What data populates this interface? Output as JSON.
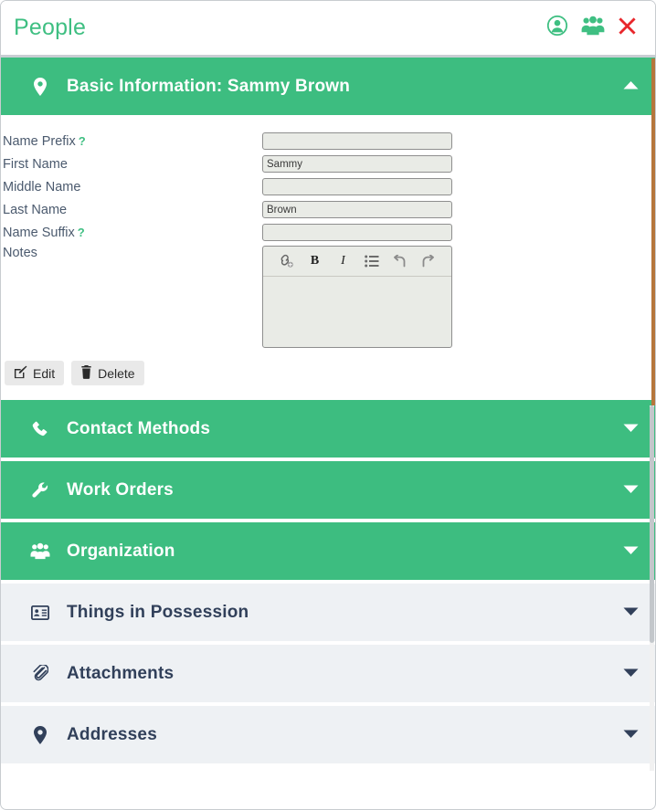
{
  "window": {
    "title": "People",
    "title_color": "#3fbf82"
  },
  "topbar": {
    "icons": [
      {
        "name": "user-circle-icon",
        "label": "User profile"
      },
      {
        "name": "users-group-icon",
        "label": "People"
      },
      {
        "name": "close-x-icon",
        "label": "Close"
      }
    ]
  },
  "colors": {
    "accent_green": "#3dbd80",
    "panel_grey": "#eef1f4",
    "label_text": "#4b5a6e",
    "header_text_dark": "#31405a",
    "close_red": "#e8262b",
    "input_bg": "#e9ebe6",
    "input_border": "#8e8e8e"
  },
  "sections": [
    {
      "key": "basic_information",
      "title": "Basic Information: Sammy Brown",
      "icon": "map-marker-icon",
      "style": "green",
      "expanded": true,
      "chevron": "chevron-up-icon"
    },
    {
      "key": "contact_methods",
      "title": "Contact Methods",
      "icon": "phone-icon",
      "style": "green",
      "expanded": false,
      "chevron": "chevron-down-icon"
    },
    {
      "key": "work_orders",
      "title": "Work Orders",
      "icon": "wrench-icon",
      "style": "green",
      "expanded": false,
      "chevron": "chevron-down-icon"
    },
    {
      "key": "organization",
      "title": "Organization",
      "icon": "users-group-icon",
      "style": "green",
      "expanded": false,
      "chevron": "chevron-down-icon"
    },
    {
      "key": "things_in_possession",
      "title": "Things in Possession",
      "icon": "id-card-icon",
      "style": "grey",
      "expanded": false,
      "chevron": "chevron-down-icon"
    },
    {
      "key": "attachments",
      "title": "Attachments",
      "icon": "paperclip-icon",
      "style": "grey",
      "expanded": false,
      "chevron": "chevron-down-icon"
    },
    {
      "key": "addresses",
      "title": "Addresses",
      "icon": "map-marker-icon",
      "style": "grey",
      "expanded": false,
      "chevron": "chevron-down-icon"
    }
  ],
  "form": {
    "fields": [
      {
        "label": "Name Prefix",
        "help": "?",
        "value": "",
        "placeholder": ""
      },
      {
        "label": "First Name",
        "help": "",
        "value": "Sammy",
        "placeholder": ""
      },
      {
        "label": "Middle Name",
        "help": "",
        "value": "",
        "placeholder": ""
      },
      {
        "label": "Last Name",
        "help": "",
        "value": "Brown",
        "placeholder": ""
      },
      {
        "label": "Name Suffix",
        "help": "?",
        "value": "",
        "placeholder": ""
      }
    ],
    "notes": {
      "label": "Notes",
      "value": "",
      "toolbar": [
        {
          "name": "insert-link-icon",
          "label": "Insert link"
        },
        {
          "name": "bold-icon",
          "label": "B"
        },
        {
          "name": "italic-icon",
          "label": "I"
        },
        {
          "name": "bullet-list-icon",
          "label": "Bulleted list"
        },
        {
          "name": "undo-icon",
          "label": "Undo"
        },
        {
          "name": "redo-icon",
          "label": "Redo"
        }
      ]
    },
    "buttons": [
      {
        "name": "edit-button",
        "label": "Edit",
        "icon": "pencil-square-icon"
      },
      {
        "name": "delete-button",
        "label": "Delete",
        "icon": "trash-icon"
      }
    ]
  }
}
